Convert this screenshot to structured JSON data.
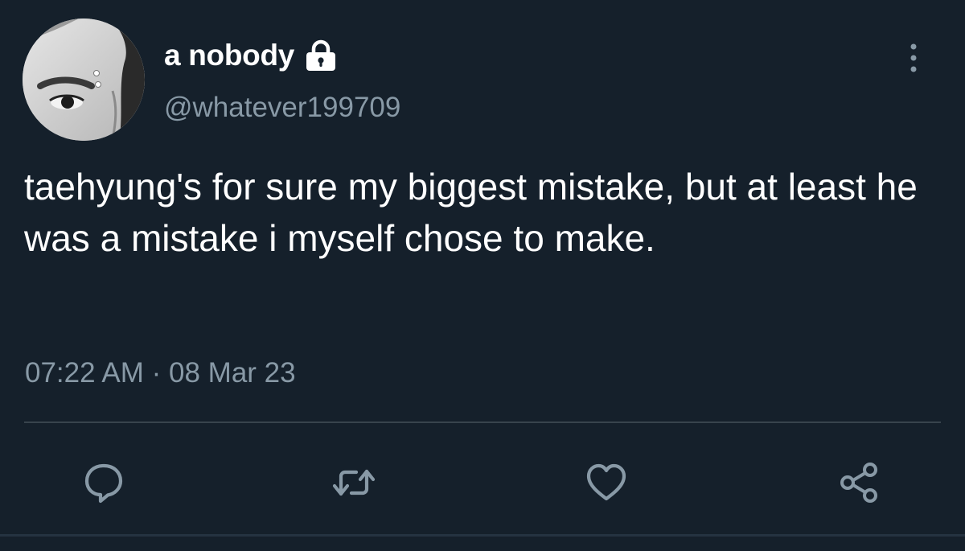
{
  "user": {
    "display_name": "a nobody",
    "handle": "@whatever199709",
    "protected_icon": "lock-icon",
    "avatar_icon": "avatar-photo"
  },
  "tweet": {
    "text": "taehyung's for sure my biggest mistake, but at least he was a mistake i myself chose to make.",
    "time": "07:22 AM",
    "separator": "·",
    "date": "08 Mar 23"
  },
  "actions": [
    {
      "name": "reply",
      "icon": "reply-icon"
    },
    {
      "name": "retweet",
      "icon": "retweet-icon"
    },
    {
      "name": "like",
      "icon": "heart-icon"
    },
    {
      "name": "share",
      "icon": "share-icon"
    }
  ],
  "menu": {
    "icon": "more-vertical-icon"
  },
  "colors": {
    "background": "#15202b",
    "primary_text": "#ffffff",
    "secondary_text": "#8899a6",
    "divider": "#38444d"
  }
}
